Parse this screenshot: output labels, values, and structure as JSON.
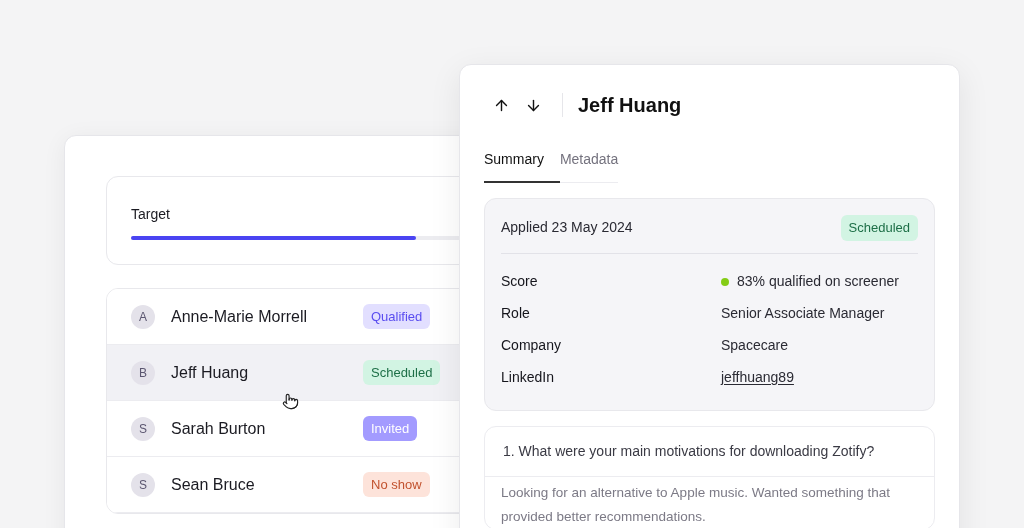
{
  "target": {
    "label": "Target",
    "level": 0.67
  },
  "participants": [
    {
      "initial": "A",
      "name": "Anne-Marie Morrell",
      "hovered": false,
      "status": {
        "label": "Qualified",
        "kind": "qualified"
      }
    },
    {
      "initial": "B",
      "name": "Jeff Huang",
      "hovered": true,
      "status": {
        "label": "Scheduled",
        "kind": "scheduled"
      }
    },
    {
      "initial": "S",
      "name": "Sarah Burton",
      "hovered": false,
      "status": {
        "label": "Invited",
        "kind": "invited"
      }
    },
    {
      "initial": "S",
      "name": "Sean Bruce",
      "hovered": false,
      "status": {
        "label": "No show",
        "kind": "noshow"
      }
    }
  ],
  "detail": {
    "title": "Jeff Huang",
    "tabs": [
      {
        "label": "Summary",
        "selected": true
      },
      {
        "label": "Metadata",
        "selected": false
      }
    ],
    "applied": "Applied 23 May 2024",
    "status": {
      "label": "Scheduled",
      "kind": "scheduled"
    },
    "fields": [
      {
        "label": "Score",
        "value": "83% qualified on screener",
        "kind": "score",
        "color": "#84cc16"
      },
      {
        "label": "Role",
        "value": "Senior Associate Manager",
        "kind": "text"
      },
      {
        "label": "Company",
        "value": "Spacecare",
        "kind": "text"
      },
      {
        "label": "LinkedIn",
        "value": "jeffhuang89",
        "kind": "link"
      }
    ],
    "question": "1. What were your main motivations for downloading Zotify?",
    "answer": "Looking for an alternative to Apple music. Wanted something that provided better recommendations."
  }
}
